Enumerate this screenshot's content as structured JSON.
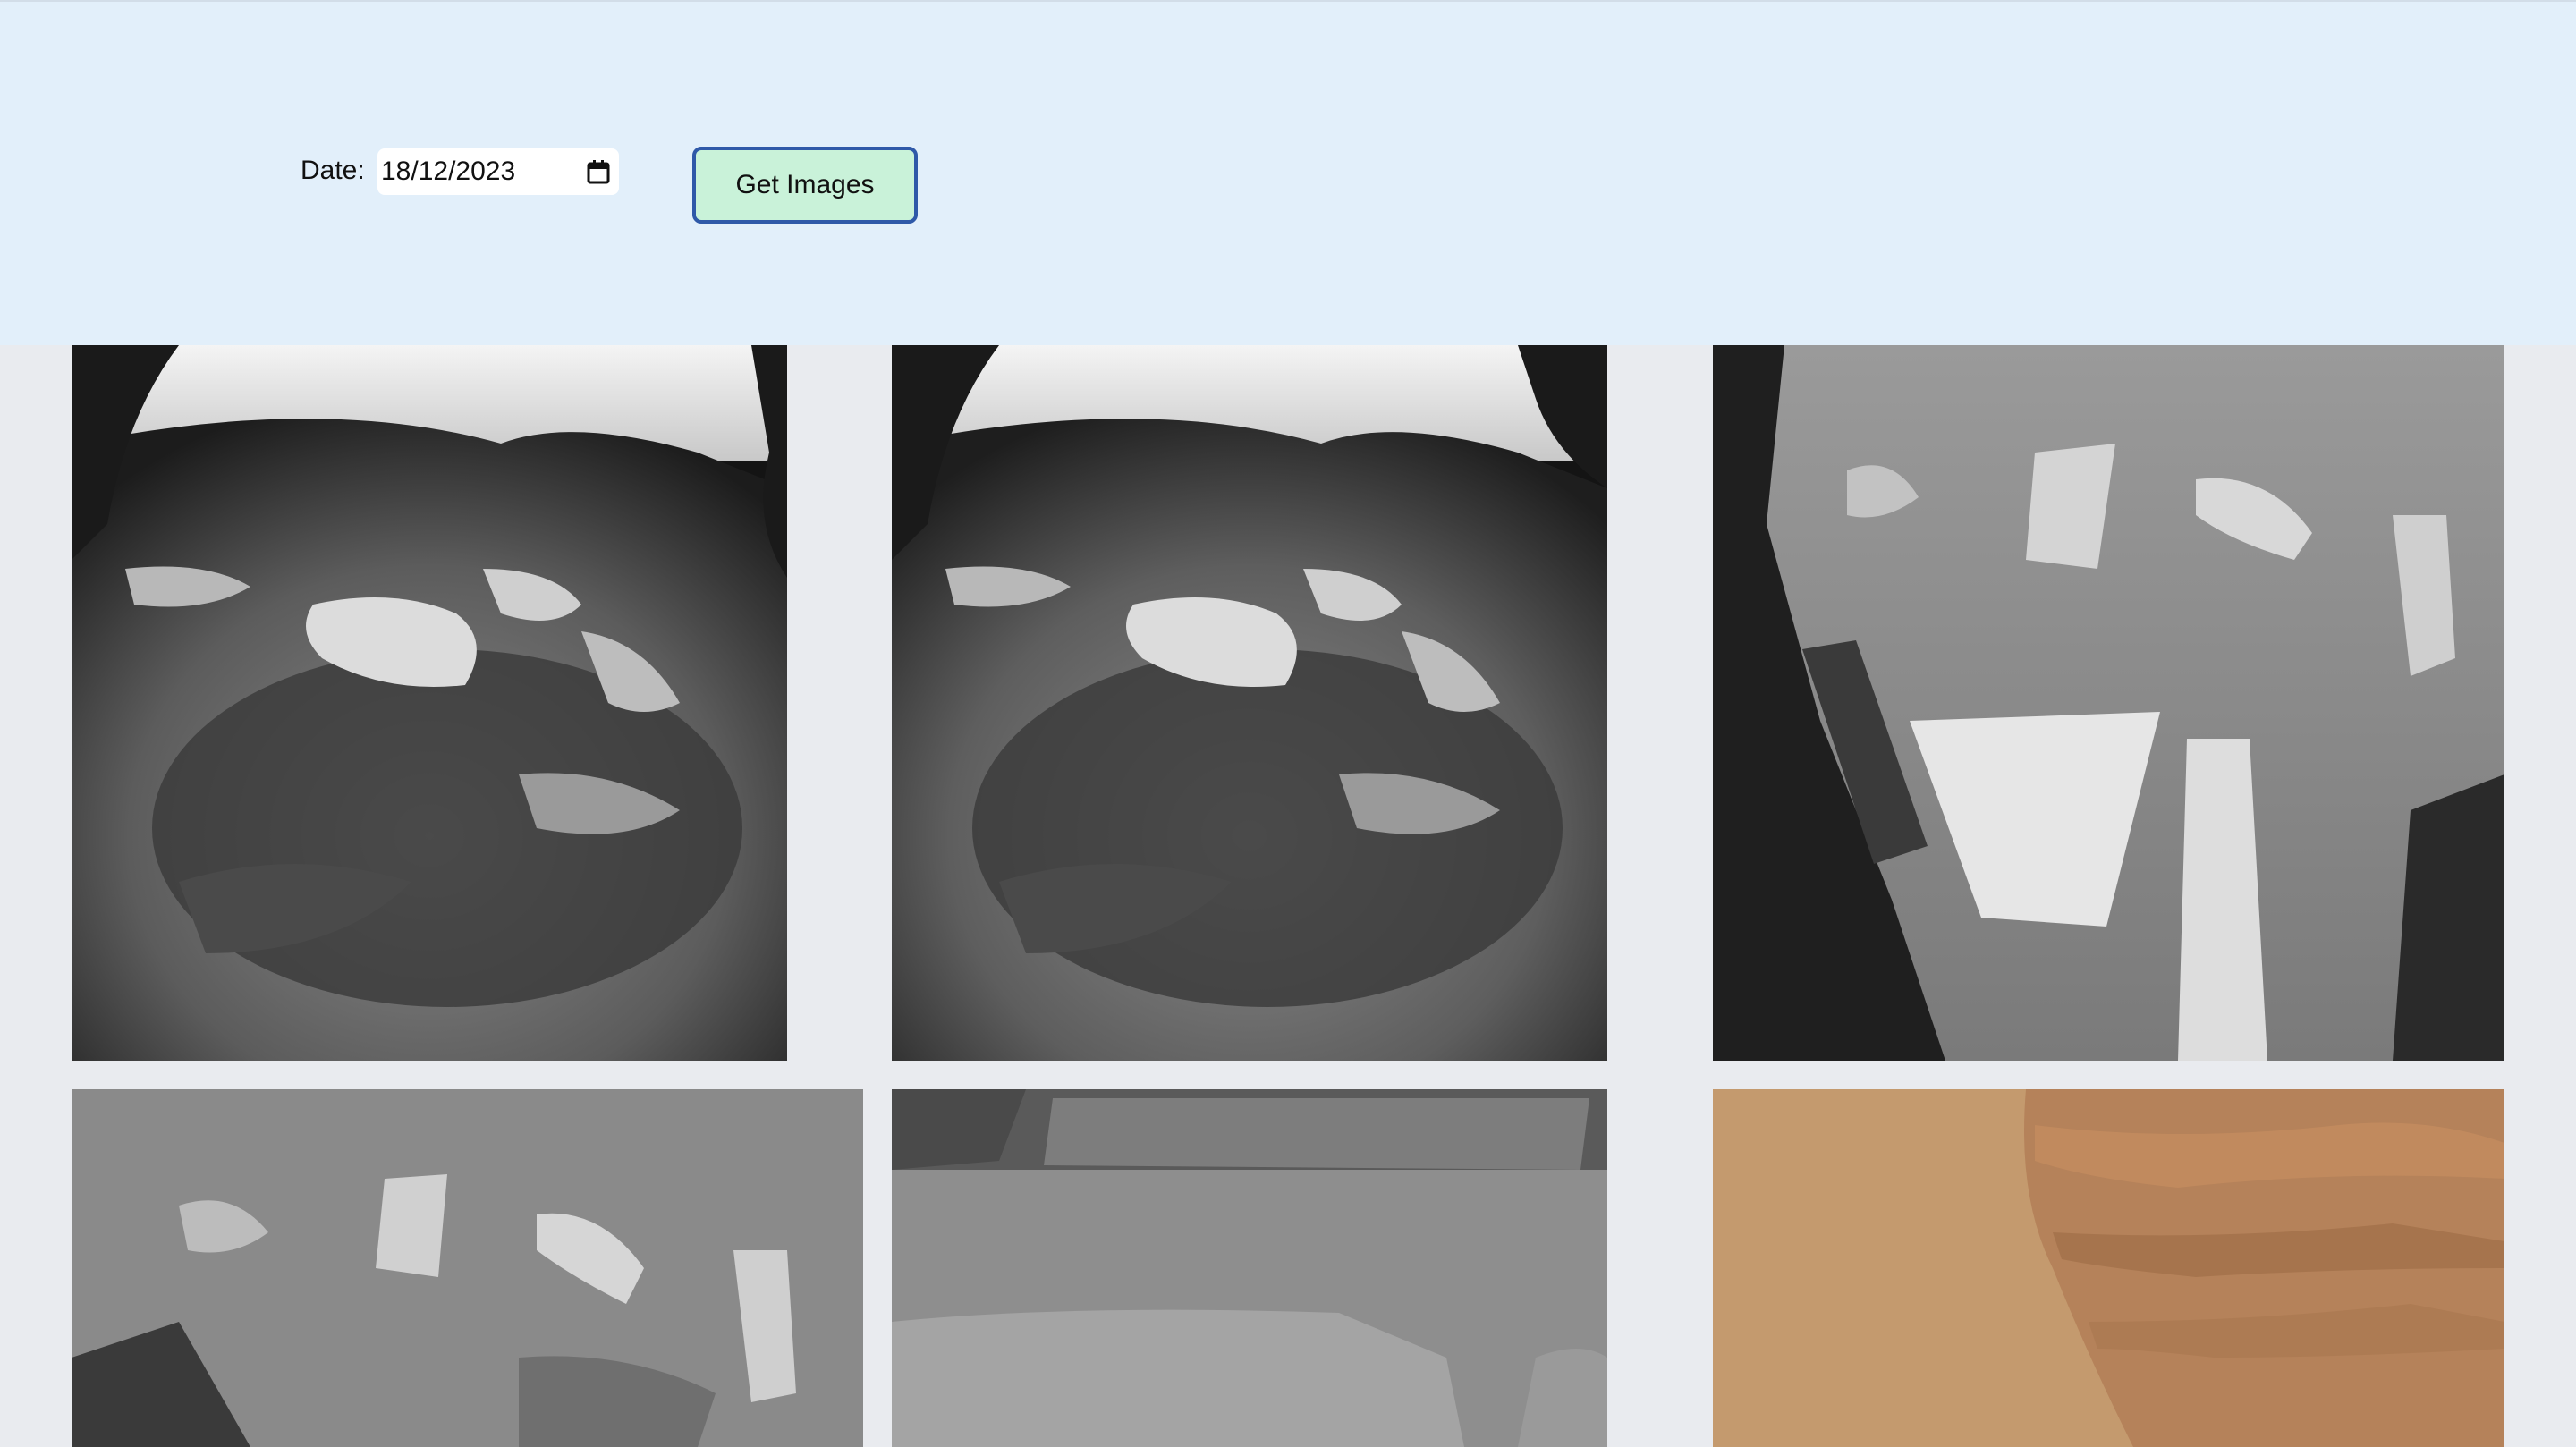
{
  "form": {
    "date_label": "Date:",
    "date_value": "18/12/2023",
    "submit_label": "Get Images"
  },
  "icons": {
    "calendar": "calendar-icon"
  },
  "colors": {
    "header_bg": "#e2effa",
    "page_bg": "#e9ebef",
    "button_bg": "#c9f2d9",
    "button_border": "#2f59a8"
  },
  "gallery": {
    "images": [
      {
        "kind": "grayscale",
        "subject": "rocky terrain with hills"
      },
      {
        "kind": "grayscale",
        "subject": "rocky terrain with hills"
      },
      {
        "kind": "grayscale",
        "subject": "rocks and rover wheel"
      },
      {
        "kind": "grayscale",
        "subject": "rocks on sand"
      },
      {
        "kind": "grayscale",
        "subject": "layered rock outcrop"
      },
      {
        "kind": "color",
        "subject": "tan layered rock on sand"
      }
    ]
  }
}
